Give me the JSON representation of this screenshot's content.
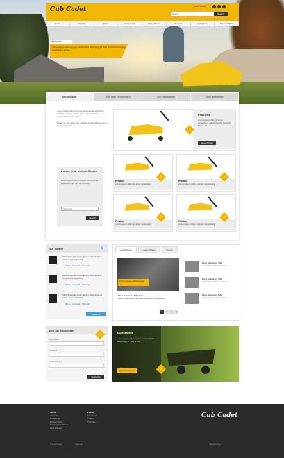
{
  "header": {
    "logo": "Cub Cadet",
    "utility_links": "Dealer Locator",
    "search_placeholder": "Search",
    "search_button": "Search",
    "nav": [
      "Home",
      "Products",
      "Parts",
      "Owners Info",
      "Find a Dealer",
      "About Us",
      "Contact Us",
      "Special Offers"
    ]
  },
  "hero": {
    "welcome_label": "Welcome",
    "banner_text": "Lorem ipsum dolor sit amet, consectetur adipiscing elit. Sed do eiusmod tempor incididunt ut labore."
  },
  "tabs": [
    "Introduction",
    "Best lawn environment",
    "Our Lawnmower",
    "Your Lawnmower"
  ],
  "intro": {
    "paragraph1": "Lorem ipsum dolor sit amet, consectetur adipiscing elit. Praesent vel mauris eget augue rhoncus elementum non eu sapien.",
    "paragraph2": "Donec at nunc felis, nec vehicula metus. Maecenas id ipsum nec quam."
  },
  "dealer": {
    "title": "Locate your nearest Dealer",
    "text": "Lorem ipsum dolor sit amet, consectetur adipiscing elit. Sed ut nisl lorem.",
    "input_placeholder": "Postcode",
    "button": "Search"
  },
  "featured": {
    "title": "Featured",
    "text": "Lorem ipsum dolor sit amet, consectetur adipiscing elit. Nunc vel libero nisl.",
    "button": "View Product"
  },
  "products": [
    {
      "name": "Product",
      "desc": "Lorem ipsum dolor sit amet consectetur"
    },
    {
      "name": "Product",
      "desc": "Lorem ipsum dolor sit amet consectetur"
    },
    {
      "name": "Product",
      "desc": "Lorem ipsum dolor sit amet consectetur"
    },
    {
      "name": "Product",
      "desc": "Lorem ipsum dolor sit amet consectetur"
    }
  ],
  "twitter": {
    "title": "Our Twitter",
    "tweets": [
      {
        "text": "Most Scenarios lorem ipsum dolor sit amet consectetur adipiscing",
        "links": [
          "Reply",
          "Retweet",
          "Favorite"
        ]
      },
      {
        "text": "Most Scenarios lorem ipsum dolor sit amet consectetur adipiscing",
        "links": [
          "Reply",
          "Retweet",
          "Favorite"
        ]
      },
      {
        "text": "Most Scenarios lorem ipsum dolor sit amet consectetur adipiscing",
        "links": [
          "Reply",
          "Retweet",
          "Favorite"
        ]
      }
    ],
    "button": "Follow us"
  },
  "media": {
    "tabs": [
      "Latest News",
      "Latest Videos",
      "Events"
    ],
    "video_caption": "Lorem ipsum dolor sit amet",
    "video_title": "Most Scenarios Title Here",
    "video_desc": "Lorem ipsum dolor sit amet, consectetur adipiscing",
    "thumbs": [
      {
        "title": "Most Scenarios Title",
        "desc": "Lorem ipsum dolor sit amet"
      },
      {
        "title": "Most Scenarios Title",
        "desc": "Lorem ipsum dolor sit amet"
      },
      {
        "title": "Most Scenarios Title",
        "desc": "Lorem ipsum dolor sit amet"
      }
    ],
    "pages": [
      "1",
      "2",
      "3",
      "4"
    ]
  },
  "newsletter": {
    "title": "Join our Newsletter",
    "fields": [
      "First Name",
      "Surname",
      "Email Address"
    ],
    "button": "Subscribe"
  },
  "promo": {
    "title": "Accessories",
    "text": "Lorem ipsum dolor sit amet, consectetur adipiscing elit. Sed ut nisl.",
    "button": "View Accessories"
  },
  "footer": {
    "logo": "Cub Cadet",
    "col1": {
      "heading": "About",
      "items": [
        "About Us",
        "Contact Us",
        "Privacy Policy",
        "Terms & Conditions",
        "Find a Dealer"
      ]
    },
    "col2": {
      "heading": "Follow",
      "items": [
        "Facebook",
        "Twitter",
        "YouTube"
      ]
    },
    "bottom_left": [
      "© Cub Cadet",
      "Sitemap"
    ],
    "bottom_right": "Back to Top"
  }
}
